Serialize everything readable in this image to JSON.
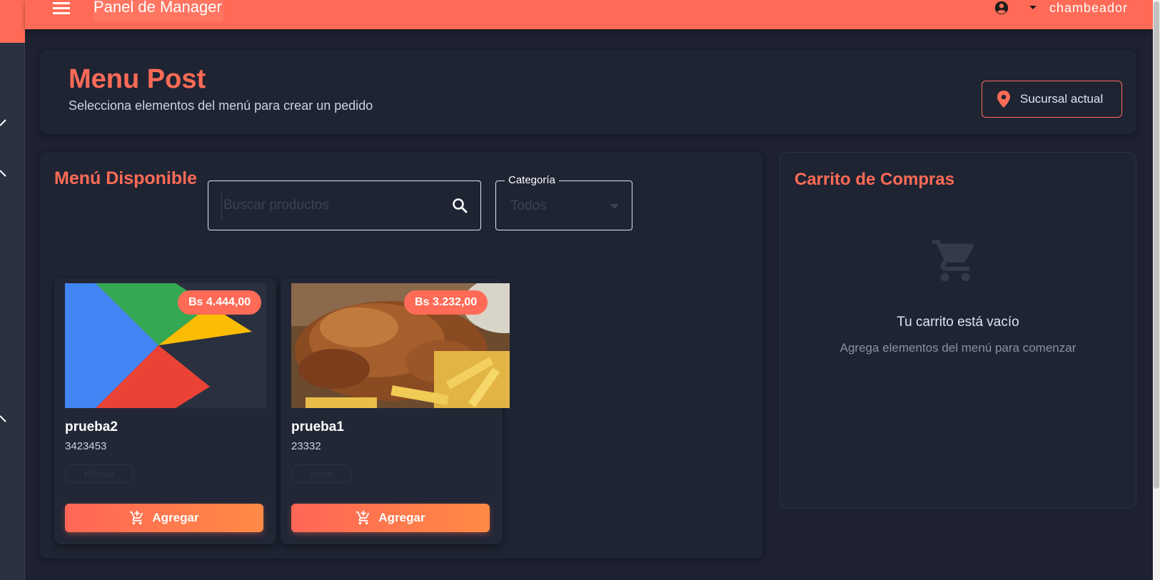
{
  "app": {
    "title": "Panel de Manager",
    "user_name": "chambeador",
    "accent_color": "#ff6b56",
    "background_color": "#1d2130"
  },
  "header": {
    "title": "Menu Post",
    "subtitle": "Selecciona elementos del menú para crear un pedido",
    "branch_button_label": "Sucursal actual"
  },
  "menu": {
    "title": "Menú Disponible",
    "search_placeholder": "Buscar productos",
    "search_value": "",
    "category_label": "Categoría",
    "category_value": "Todos",
    "add_button_label": "Agregar",
    "products": [
      {
        "name": "prueba2",
        "code": "3423453",
        "price": "Bs 4.444,00",
        "tag": "rtfeesa",
        "image": "google-play-logo"
      },
      {
        "name": "prueba1",
        "code": "23332",
        "price": "Bs 3.232,00",
        "tag": "none",
        "image": "roast-chicken-with-fries"
      }
    ]
  },
  "cart": {
    "title": "Carrito de Compras",
    "empty_title": "Tu carrito está vacío",
    "empty_subtitle": "Agrega elementos del menú para comenzar",
    "icon": "shopping-cart-icon"
  }
}
